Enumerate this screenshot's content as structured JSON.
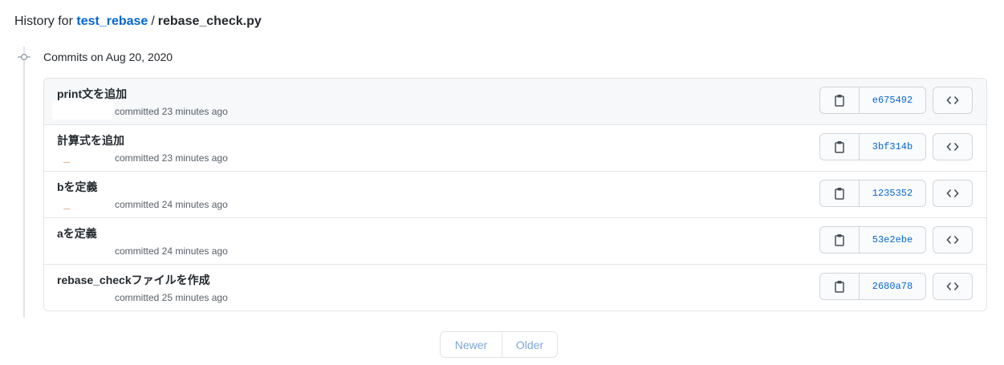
{
  "header": {
    "prefix": "History for",
    "repo": "test_rebase",
    "separator": "/",
    "file": "rebase_check.py"
  },
  "timeline": {
    "heading": "Commits on Aug 20, 2020"
  },
  "commits": [
    {
      "message": "print文を追加",
      "meta": "committed 23 minutes ago",
      "sha": "e675492"
    },
    {
      "message": "計算式を追加",
      "meta": "committed 23 minutes ago",
      "sha": "3bf314b"
    },
    {
      "message": "bを定義",
      "meta": "committed 24 minutes ago",
      "sha": "1235352"
    },
    {
      "message": "aを定義",
      "meta": "committed 24 minutes ago",
      "sha": "53e2ebe"
    },
    {
      "message": "rebase_checkファイルを作成",
      "meta": "committed 25 minutes ago",
      "sha": "2680a78"
    }
  ],
  "pagination": {
    "newer_label": "Newer",
    "older_label": "Older"
  },
  "icons": {
    "copy": "clipboard-icon",
    "browse": "code-icon",
    "timeline": "commit-node-icon"
  },
  "colors": {
    "link": "#0366d6",
    "border": "#e1e4e8",
    "disabled_link": "#7ea6d6"
  }
}
